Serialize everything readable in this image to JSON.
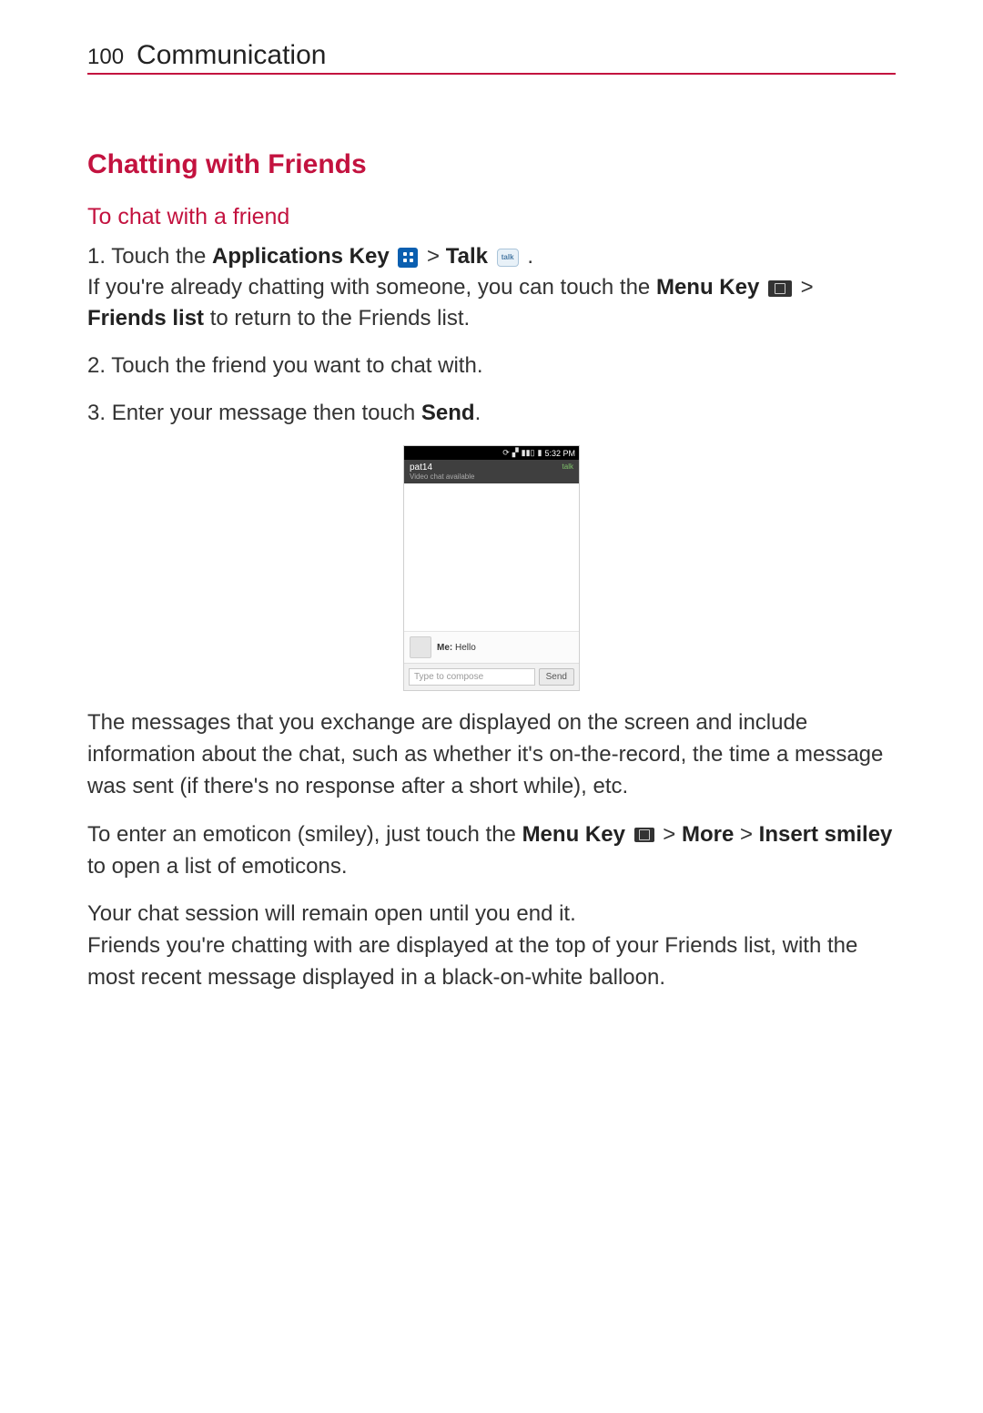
{
  "header": {
    "page_number": "100",
    "section": "Communication"
  },
  "section_title": "Chatting with Friends",
  "subsection_title": "To chat with a friend",
  "steps": {
    "s1": {
      "num": "1. ",
      "t1": "Touch the ",
      "apps_key": "Applications Key",
      "gt1": " > ",
      "talk": "Talk",
      "tail": " .",
      "line2a": "If you're already chatting with someone, you can touch the ",
      "menu_key": "Menu Key",
      "gt2": " > ",
      "friends_list": "Friends list",
      "line2b": " to return to the Friends list."
    },
    "s2": {
      "num": "2. ",
      "text": "Touch the friend you want to chat with."
    },
    "s3": {
      "num": "3. ",
      "t1": "Enter your message then touch ",
      "send": "Send",
      "tail": "."
    }
  },
  "shot": {
    "time": "5:32 PM",
    "user": "pat14",
    "status": "Video chat available",
    "talk_label": "talk",
    "msg_prefix": "Me:",
    "msg_text": " Hello",
    "placeholder": "Type to compose",
    "send": "Send"
  },
  "paras": {
    "p1": "The messages that you exchange are displayed on the screen and include information about the chat, such as whether it's on-the-record, the time a message was sent (if there's no response after a short while), etc.",
    "p2": {
      "a": "To enter an emoticon (smiley), just touch the ",
      "menu_key": "Menu Key",
      "gt": " > ",
      "more": "More",
      "gt2": " > ",
      "insert": "Insert smiley",
      "b": " to open a list of emoticons."
    },
    "p3": "Your chat session will remain open until you end it.",
    "p4": "Friends you're chatting with are displayed at the top of your Friends list, with the most recent message displayed in a black-on-white balloon."
  },
  "icons": {
    "talk_badge": "talk"
  }
}
